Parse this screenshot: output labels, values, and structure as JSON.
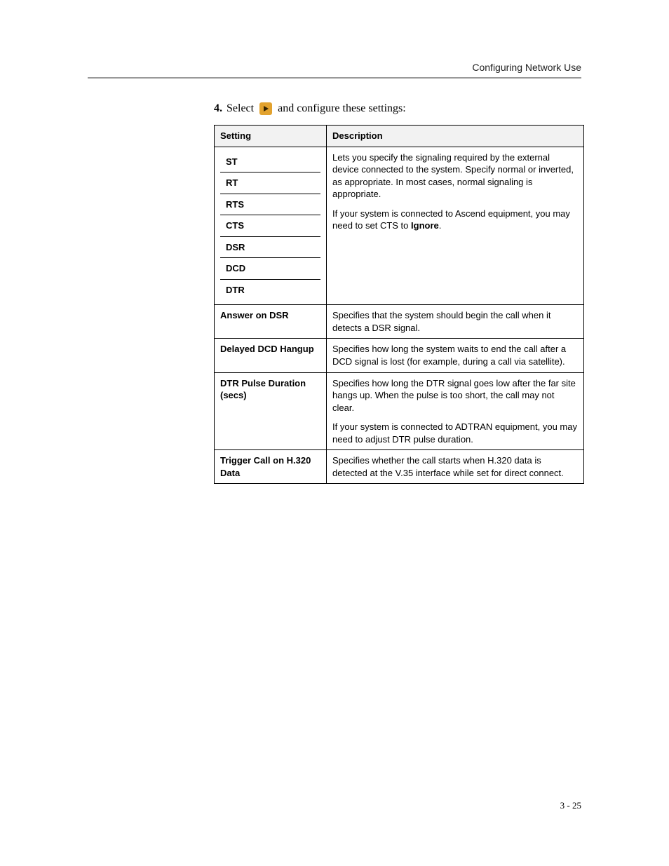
{
  "header": {
    "section_title": "Configuring Network Use"
  },
  "step": {
    "number": "4.",
    "before_icon": "Select",
    "icon_name": "play-icon",
    "after_icon": "and configure these settings:"
  },
  "table": {
    "headers": {
      "setting": "Setting",
      "description": "Description"
    },
    "signal_group": {
      "items": [
        "ST",
        "RT",
        "RTS",
        "CTS",
        "DSR",
        "DCD",
        "DTR"
      ],
      "desc_p1_a": "Lets you specify the signaling required by the external device connected to the system. Specify normal or inverted, as appropriate. In most cases, normal signaling is appropriate.",
      "desc_p2_a": "If your system is connected to Ascend equipment, you may need to set CTS to ",
      "desc_p2_bold": "Ignore",
      "desc_p2_b": "."
    },
    "rows": [
      {
        "setting": "Answer on DSR",
        "desc": "Specifies that the system should begin the call when it detects a DSR signal."
      },
      {
        "setting": "Delayed DCD Hangup",
        "desc": "Specifies how long the system waits to end the call after a DCD signal is lost (for example, during a call via satellite)."
      },
      {
        "setting": "DTR Pulse Duration (secs)",
        "desc": "Specifies how long the DTR signal goes low after the far site hangs up. When the pulse is too short, the call may not clear.",
        "desc2": "If your system is connected to ADTRAN equipment, you may need to adjust DTR pulse duration."
      },
      {
        "setting": "Trigger Call on H.320 Data",
        "desc": "Specifies whether the call starts when H.320 data is detected at the V.35 interface while set for direct connect."
      }
    ]
  },
  "footer": {
    "page_number": "3 - 25"
  }
}
